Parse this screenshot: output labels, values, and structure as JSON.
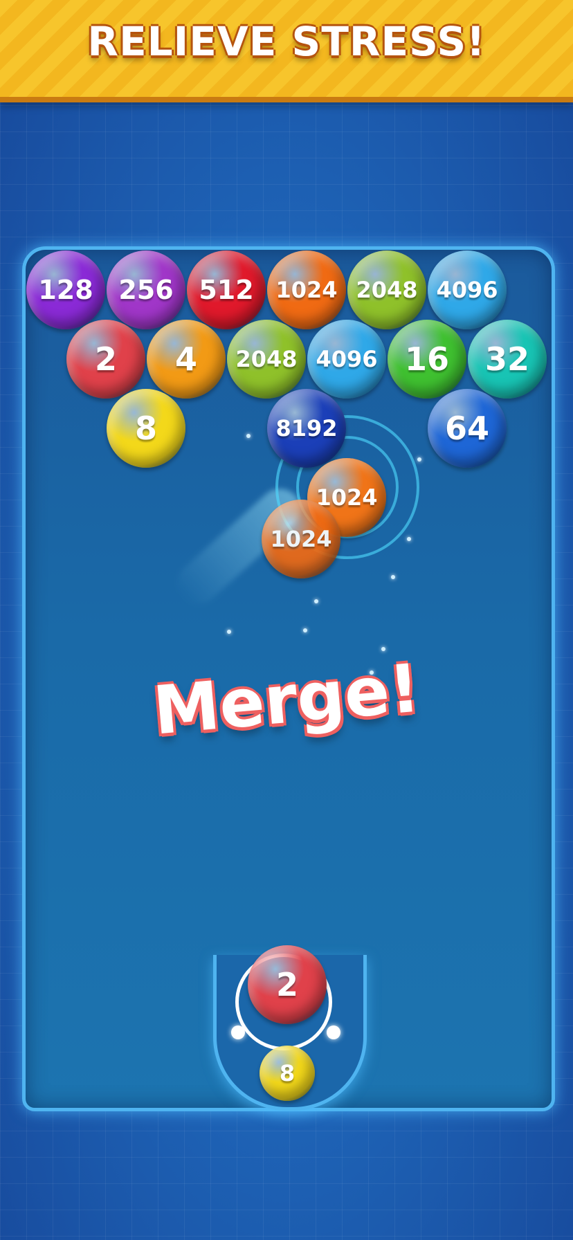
{
  "banner": {
    "title": "RELIEVE STRESS!"
  },
  "effect_text": "Merge!",
  "balls": [
    {
      "label": "128",
      "color": "#8a2ad6"
    },
    {
      "label": "256",
      "color": "#a036c8"
    },
    {
      "label": "512",
      "color": "#e0192b"
    },
    {
      "label": "1024",
      "color": "#f06a13"
    },
    {
      "label": "2048",
      "color": "#8fc12a"
    },
    {
      "label": "4096",
      "color": "#2fa8e8"
    },
    {
      "label": "2",
      "color": "#e0414a"
    },
    {
      "label": "4",
      "color": "#f29a15"
    },
    {
      "label": "2048",
      "color": "#8fc12a"
    },
    {
      "label": "4096",
      "color": "#2fa8e8"
    },
    {
      "label": "16",
      "color": "#3fc030"
    },
    {
      "label": "32",
      "color": "#18c4b4"
    },
    {
      "label": "8",
      "color": "#f3d81a"
    },
    {
      "label": "8192",
      "color": "#1b3fb8"
    },
    {
      "label": "64",
      "color": "#1e66d6"
    },
    {
      "label": "1024",
      "color": "#f07418"
    },
    {
      "label": "1024",
      "color": "#f06a13"
    }
  ],
  "shooter": {
    "current": {
      "label": "2",
      "color": "#e0414a"
    },
    "next": {
      "label": "8",
      "color": "#f3d81a"
    }
  }
}
